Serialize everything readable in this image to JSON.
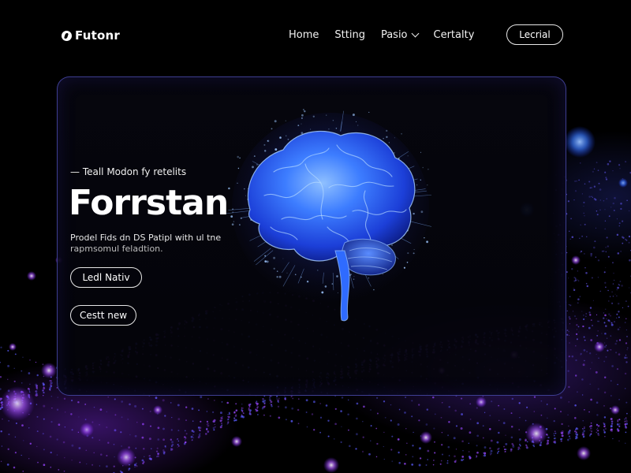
{
  "nav": {
    "logo_text": "Futonr",
    "logo_icon": "logo-mark-icon",
    "links": [
      {
        "label": "Home"
      },
      {
        "label": "Stting"
      },
      {
        "label": "Pasio",
        "has_dropdown": true
      },
      {
        "label": "Certalty"
      }
    ],
    "cta_label": "Lecrial"
  },
  "hero": {
    "eyebrow": "— Teall Modon fy retelits",
    "title": "Forrstan",
    "description_line1": "Prodel Fids dn DS Patipl with ul tne",
    "description_line2": "rapmsomul feladtion.",
    "primary_button": "Ledl Nativ",
    "secondary_button": "Cestt new"
  },
  "colors": {
    "background": "#000000",
    "panel_border": "#6e6eff",
    "brain_glow": "#2f6bff",
    "particles_purple": "#a040ff",
    "particles_blue": "#3a7bff"
  }
}
